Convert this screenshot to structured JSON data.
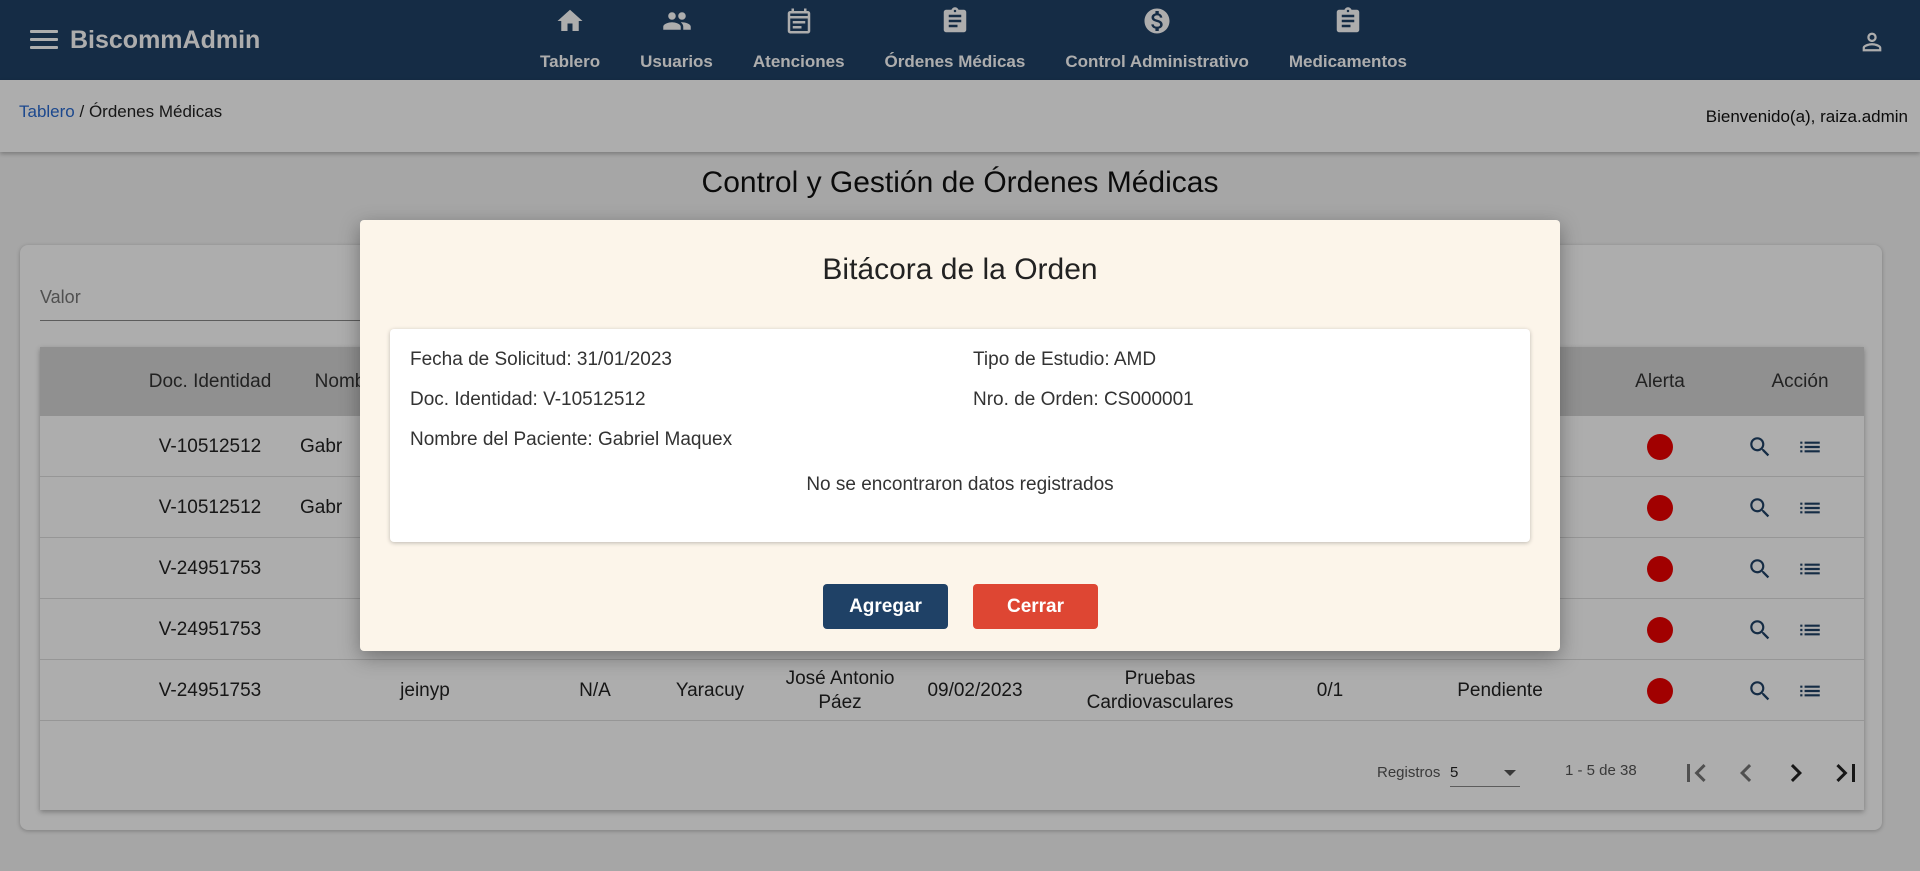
{
  "app": {
    "brand": "BiscommAdmin"
  },
  "nav": [
    {
      "label": "Tablero",
      "icon": "home-icon"
    },
    {
      "label": "Usuarios",
      "icon": "people-icon"
    },
    {
      "label": "Atenciones",
      "icon": "calendar-icon"
    },
    {
      "label": "Órdenes Médicas",
      "icon": "clipboard-icon"
    },
    {
      "label": "Control Administrativo",
      "icon": "dollar-icon"
    },
    {
      "label": "Medicamentos",
      "icon": "clipboard-icon"
    }
  ],
  "breadcrumb": {
    "link": "Tablero",
    "separator": " / ",
    "current": "Órdenes Médicas"
  },
  "welcome": "Bienvenido(a), raiza.admin",
  "page": {
    "title": "Control y Gestión de Órdenes Médicas"
  },
  "filter": {
    "placeholder": "Valor"
  },
  "table": {
    "headers": {
      "doc": "Doc. Identidad",
      "nombre": "Nomb",
      "alerta": "Alerta",
      "accion": "Acción"
    },
    "rows": [
      {
        "doc": "V-10512512",
        "nombre": "Gabr"
      },
      {
        "doc": "V-10512512",
        "nombre": "Gabr"
      },
      {
        "doc": "V-24951753",
        "nombre": ""
      },
      {
        "doc": "V-24951753",
        "nombre": ""
      },
      {
        "doc": "V-24951753",
        "nombre": "jeinyp",
        "c3": "N/A",
        "c4": "Yaracuy",
        "c5": "José Antonio Páez",
        "c6": "09/02/2023",
        "c7": "Pruebas Cardiovasculares",
        "c8": "0/1",
        "c9": "Pendiente"
      }
    ],
    "alert_color": "#e00000"
  },
  "paginator": {
    "label": "Registros",
    "page_size": "5",
    "range": "1 - 5 de 38"
  },
  "modal": {
    "title": "Bitácora de la Orden",
    "fecha": "Fecha de Solicitud: 31/01/2023",
    "tipo": "Tipo de Estudio: AMD",
    "doc": "Doc. Identidad: V-10512512",
    "orden": "Nro. de Orden: CS000001",
    "paciente": "Nombre del Paciente: Gabriel Maquex",
    "nodata": "No se encontraron datos registrados",
    "add_label": "Agregar",
    "close_label": "Cerrar"
  },
  "colors": {
    "primary": "#1f4166",
    "danger": "#de4633",
    "link": "#2a6bd1"
  }
}
